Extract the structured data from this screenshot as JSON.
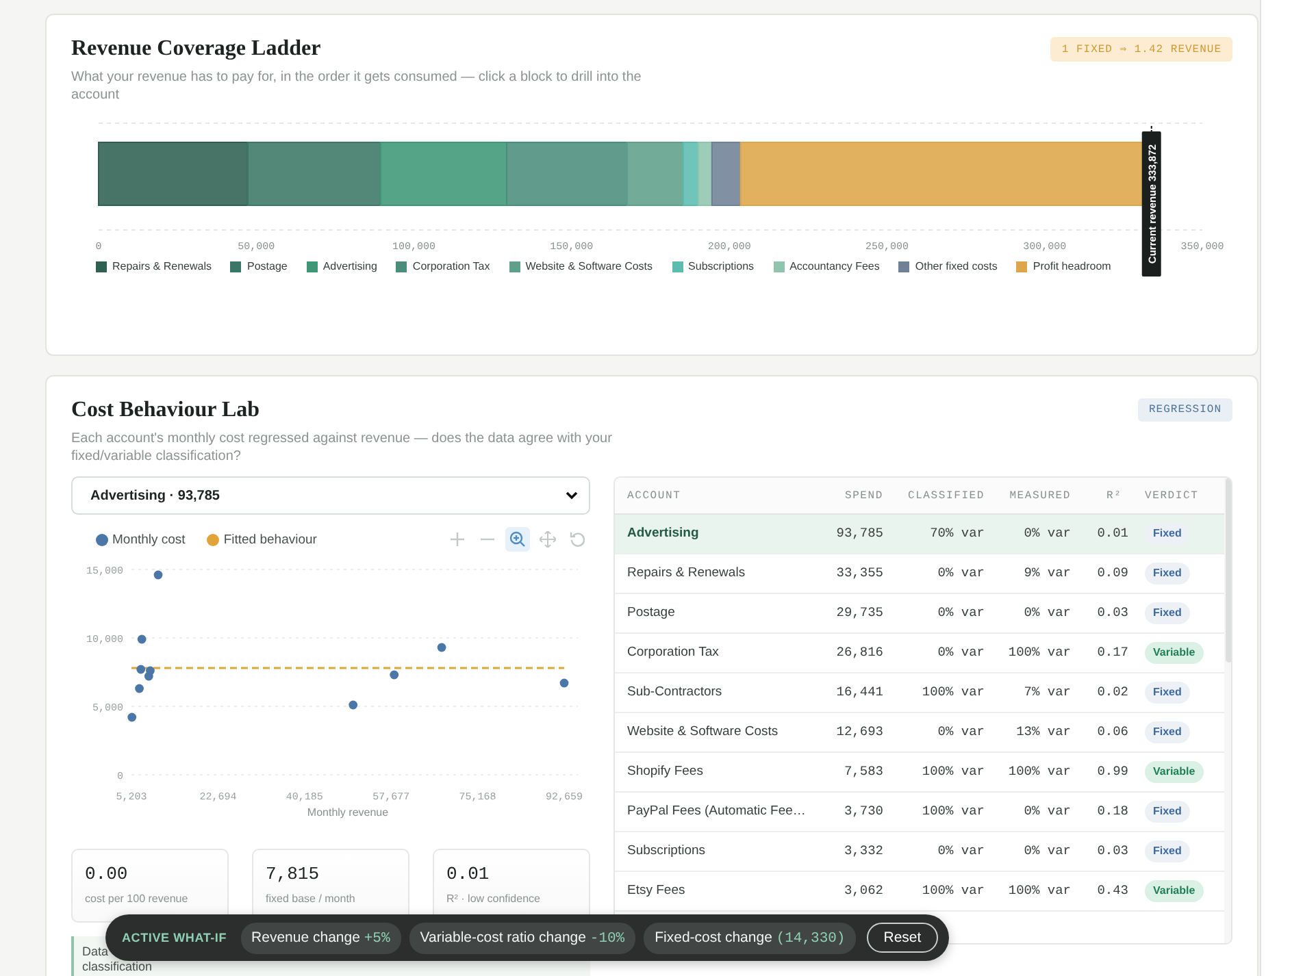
{
  "ladder": {
    "title": "Revenue Coverage Ladder",
    "subtitle": "What your revenue has to pay for, in the order it gets consumed — click a block to drill into the account",
    "badge": "1 FIXED ⇒ 1.42 REVENUE",
    "chart_data": {
      "type": "bar",
      "orientation": "horizontal",
      "stacked": true,
      "xlim": [
        0,
        350000
      ],
      "xticks": [
        {
          "value": 0,
          "label": "0"
        },
        {
          "value": 50000,
          "label": "50,000"
        },
        {
          "value": 100000,
          "label": "100,000"
        },
        {
          "value": 150000,
          "label": "150,000"
        },
        {
          "value": 200000,
          "label": "200,000"
        },
        {
          "value": 250000,
          "label": "250,000"
        },
        {
          "value": 300000,
          "label": "300,000"
        },
        {
          "value": 350000,
          "label": "350,000"
        }
      ],
      "series": [
        {
          "name": "Repairs & Renewals",
          "color": "#2f6152",
          "values": [
            47300
          ]
        },
        {
          "name": "Postage",
          "color": "#3b7766",
          "values": [
            42100
          ]
        },
        {
          "name": "Advertising",
          "color": "#3f9777",
          "values": [
            40000
          ]
        },
        {
          "name": "Corporation Tax",
          "color": "#4b8d7b",
          "values": [
            38200
          ]
        },
        {
          "name": "Website & Software Costs",
          "color": "#5fa08b",
          "values": [
            17800
          ]
        },
        {
          "name": "Subscriptions",
          "color": "#5cbcb0",
          "values": [
            4800
          ]
        },
        {
          "name": "Accountancy Fees",
          "color": "#8fc5ae",
          "values": [
            4300
          ]
        },
        {
          "name": "Other fixed costs",
          "color": "#708196",
          "values": [
            9100
          ]
        },
        {
          "name": "Profit headroom",
          "color": "#dea64a",
          "values": [
            130300
          ]
        }
      ],
      "annotations": [
        {
          "x": 333872,
          "text": "Current revenue 333,872"
        }
      ]
    }
  },
  "lab": {
    "title": "Cost Behaviour Lab",
    "subtitle": "Each account's monthly cost regressed against revenue — does the data agree with your fixed/variable classification?",
    "badge": "REGRESSION",
    "account_select": {
      "value": "Advertising · 93,785"
    },
    "chart_tools": [
      {
        "kind": "plus",
        "selected": false
      },
      {
        "kind": "minus",
        "selected": false
      },
      {
        "kind": "zoom",
        "selected": true
      },
      {
        "kind": "pan",
        "selected": false
      },
      {
        "kind": "reset",
        "selected": false
      }
    ],
    "chart_data": {
      "type": "scatter",
      "legend": "top",
      "xlabel": "Monthly revenue",
      "xlim": [
        5203,
        92659
      ],
      "ylim": [
        0,
        15000
      ],
      "x": [
        10600,
        7300,
        7100,
        9000,
        8700,
        6800,
        5300,
        50000,
        58300,
        67900,
        92659
      ],
      "xticks": [
        {
          "value": 5203,
          "label": "5,203"
        },
        {
          "value": 22694,
          "label": "22,694"
        },
        {
          "value": 40185,
          "label": "40,185"
        },
        {
          "value": 57677,
          "label": "57,677"
        },
        {
          "value": 75168,
          "label": "75,168"
        },
        {
          "value": 92659,
          "label": "92,659"
        }
      ],
      "yticks": [
        {
          "value": 0,
          "label": "0"
        },
        {
          "value": 5000,
          "label": "5,000"
        },
        {
          "value": 10000,
          "label": "10,000"
        },
        {
          "value": 15000,
          "label": "15,000"
        }
      ],
      "series": [
        {
          "name": "Monthly cost",
          "color": "#4a77a8",
          "values": [
            14600,
            9900,
            7700,
            7600,
            7200,
            6300,
            4200,
            5100,
            7300,
            9300,
            6700
          ]
        }
      ],
      "ref_lines": [
        {
          "axis": "y",
          "value": 7800,
          "label": "Fitted behaviour",
          "color": "#e0a43a"
        }
      ]
    },
    "stats": [
      {
        "value": "0.00",
        "label": "cost per 100 revenue"
      },
      {
        "value": "7,815",
        "label": "fixed base / month"
      },
      {
        "value": "0.01",
        "label": "R² · low confidence"
      }
    ],
    "verdict_note": [
      "Data",
      "classification"
    ],
    "table": {
      "columns": [
        "ACCOUNT",
        "SPEND",
        "CLASSIFIED",
        "MEASURED",
        "R²",
        "VERDICT"
      ],
      "rows": [
        {
          "account": "Advertising",
          "spend": "93,785",
          "classified": "70% var",
          "measured": "0% var",
          "r2": "0.01",
          "verdict": {
            "label": "Fixed",
            "kind": "fixed"
          },
          "selected": true
        },
        {
          "account": "Repairs & Renewals",
          "spend": "33,355",
          "classified": "0% var",
          "measured": "9% var",
          "r2": "0.09",
          "verdict": {
            "label": "Fixed",
            "kind": "fixed"
          },
          "selected": false
        },
        {
          "account": "Postage",
          "spend": "29,735",
          "classified": "0% var",
          "measured": "0% var",
          "r2": "0.03",
          "verdict": {
            "label": "Fixed",
            "kind": "fixed"
          },
          "selected": false
        },
        {
          "account": "Corporation Tax",
          "spend": "26,816",
          "classified": "0% var",
          "measured": "100% var",
          "r2": "0.17",
          "verdict": {
            "label": "Variable",
            "kind": "variable"
          },
          "selected": false
        },
        {
          "account": "Sub-Contractors",
          "spend": "16,441",
          "classified": "100% var",
          "measured": "7% var",
          "r2": "0.02",
          "verdict": {
            "label": "Fixed",
            "kind": "fixed"
          },
          "selected": false
        },
        {
          "account": "Website & Software Costs",
          "spend": "12,693",
          "classified": "0% var",
          "measured": "13% var",
          "r2": "0.06",
          "verdict": {
            "label": "Fixed",
            "kind": "fixed"
          },
          "selected": false
        },
        {
          "account": "Shopify Fees",
          "spend": "7,583",
          "classified": "100% var",
          "measured": "100% var",
          "r2": "0.99",
          "verdict": {
            "label": "Variable",
            "kind": "variable"
          },
          "selected": false
        },
        {
          "account": "PayPal Fees (Automatic Fee…",
          "spend": "3,730",
          "classified": "100% var",
          "measured": "0% var",
          "r2": "0.18",
          "verdict": {
            "label": "Fixed",
            "kind": "fixed"
          },
          "selected": false
        },
        {
          "account": "Subscriptions",
          "spend": "3,332",
          "classified": "0% var",
          "measured": "0% var",
          "r2": "0.03",
          "verdict": {
            "label": "Fixed",
            "kind": "fixed"
          },
          "selected": false
        },
        {
          "account": "Etsy Fees",
          "spend": "3,062",
          "classified": "100% var",
          "measured": "100% var",
          "r2": "0.43",
          "verdict": {
            "label": "Variable",
            "kind": "variable"
          },
          "selected": false
        }
      ]
    }
  },
  "whatif": {
    "label": "ACTIVE WHAT-IF",
    "chips": [
      {
        "label": "Revenue change",
        "value": "+5%"
      },
      {
        "label": "Variable-cost ratio change",
        "value": "-10%"
      },
      {
        "label": "Fixed-cost change",
        "value": "(14,330)"
      }
    ],
    "reset": "Reset"
  }
}
